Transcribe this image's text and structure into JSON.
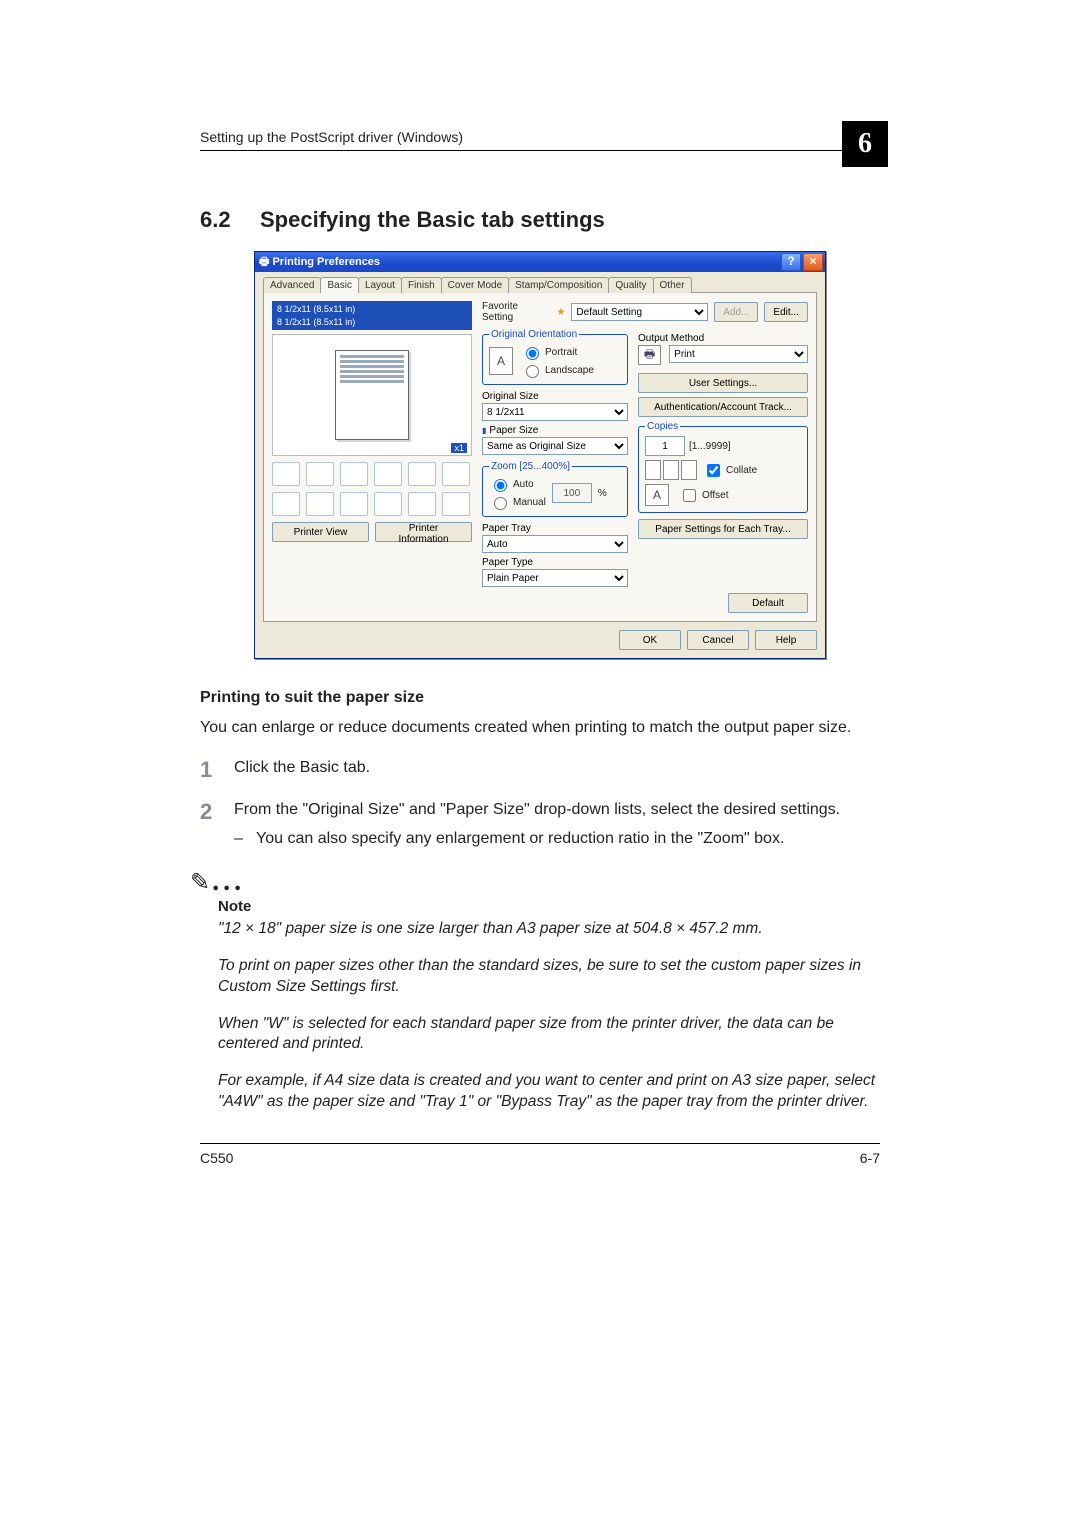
{
  "header": {
    "running": "Setting up the PostScript driver (Windows)",
    "chapter": "6"
  },
  "section": {
    "num": "6.2",
    "title": "Specifying the Basic tab settings"
  },
  "dialog": {
    "title": "Printing Preferences",
    "tabs": [
      "Advanced",
      "Basic",
      "Layout",
      "Finish",
      "Cover Mode",
      "Stamp/Composition",
      "Quality",
      "Other"
    ],
    "active_tab": 1,
    "favorite": {
      "label": "Favorite Setting",
      "value": "Default Setting",
      "add": "Add...",
      "edit": "Edit..."
    },
    "sizebox": {
      "line1": "8 1/2x11 (8.5x11 in)",
      "line2": "8 1/2x11 (8.5x11 in)"
    },
    "orientation": {
      "legend": "Original Orientation",
      "portrait": "Portrait",
      "landscape": "Landscape"
    },
    "original_size": {
      "label": "Original Size",
      "value": "8 1/2x11"
    },
    "paper_size": {
      "label": "Paper Size",
      "value": "Same as Original Size"
    },
    "zoom": {
      "legend": "Zoom [25...400%]",
      "auto": "Auto",
      "manual": "Manual",
      "value": "100",
      "pct": "%"
    },
    "paper_tray": {
      "label": "Paper Tray",
      "value": "Auto"
    },
    "paper_type": {
      "label": "Paper Type",
      "value": "Plain Paper"
    },
    "output_method": {
      "label": "Output Method",
      "value": "Print"
    },
    "user_settings": "User Settings...",
    "auth": "Authentication/Account Track...",
    "copies": {
      "legend": "Copies",
      "value": "1",
      "range": "[1...9999]",
      "collate": "Collate",
      "offset": "Offset"
    },
    "paper_settings": "Paper Settings for Each Tray...",
    "printer_view": "Printer View",
    "printer_info": "Printer Information",
    "default_btn": "Default",
    "ok": "OK",
    "cancel": "Cancel",
    "help": "Help"
  },
  "body": {
    "h3": "Printing to suit the paper size",
    "intro": "You can enlarge or reduce documents created when printing to match the output paper size.",
    "steps": [
      {
        "n": "1",
        "t": "Click the Basic tab."
      },
      {
        "n": "2",
        "t": "From the \"Original Size\" and \"Paper Size\" drop-down lists, select the desired settings.",
        "sub": "You can also specify any enlargement or reduction ratio in the \"Zoom\" box."
      }
    ],
    "note_label": "Note",
    "notes": [
      "\"12 × 18\" paper size is one size larger than A3 paper size at 504.8 × 457.2 mm.",
      "To print on paper sizes other than the standard sizes, be sure to set the custom paper sizes in Custom Size Settings first.",
      "When \"W\" is selected for each standard paper size from the printer driver, the data can be centered and printed.",
      "For example, if A4 size data is created and you want to center and print on A3 size paper, select \"A4W\" as the paper size and \"Tray 1\" or \"Bypass Tray\" as the paper tray from the printer driver."
    ]
  },
  "footer": {
    "model": "C550",
    "page": "6-7"
  }
}
